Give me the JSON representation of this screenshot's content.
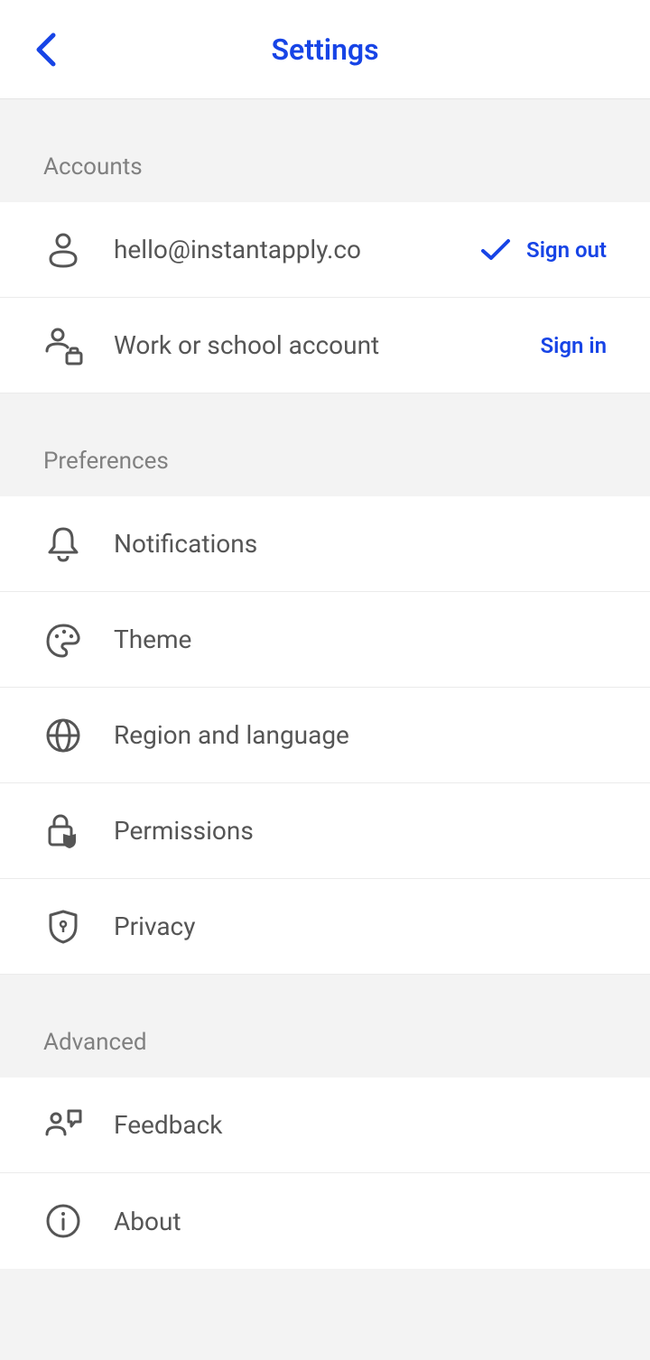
{
  "header": {
    "title": "Settings"
  },
  "sections": {
    "accounts": {
      "header": "Accounts",
      "email": "hello@instantapply.co",
      "sign_out": "Sign out",
      "work_school": "Work or school account",
      "sign_in": "Sign in"
    },
    "preferences": {
      "header": "Preferences",
      "notifications": "Notifications",
      "theme": "Theme",
      "region": "Region and language",
      "permissions": "Permissions",
      "privacy": "Privacy"
    },
    "advanced": {
      "header": "Advanced",
      "feedback": "Feedback",
      "about": "About"
    }
  }
}
